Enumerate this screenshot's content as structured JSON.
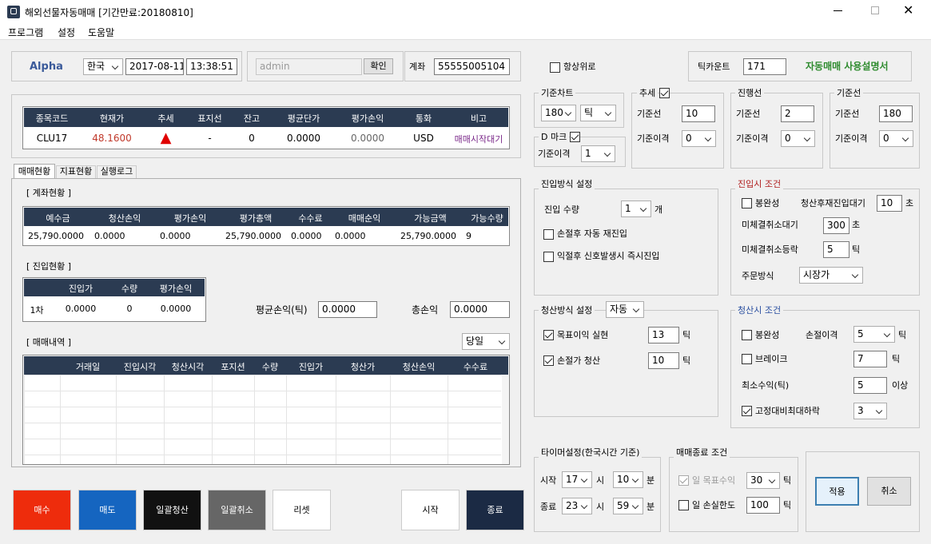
{
  "window": {
    "title": "해외선물자동매매 [기간만료:20180810]"
  },
  "menu": [
    "프로그램",
    "설정",
    "도움말"
  ],
  "header": {
    "brand": "Alpha",
    "country": "한국",
    "date": "2017-08-11",
    "time": "13:38:51",
    "user": "admin",
    "confirm": "확인",
    "account_label": "계좌",
    "account": "55555005104",
    "always_top": "항상위로",
    "tick_label": "틱카운트",
    "tick_count": "171",
    "manual": "자동매매 사용설명서"
  },
  "quote": {
    "headers": [
      "종목코드",
      "현재가",
      "추세",
      "표지선",
      "잔고",
      "평균단가",
      "평가손익",
      "통화",
      "비고"
    ],
    "row": [
      "CLU17",
      "48.1600",
      "▲",
      "-",
      "0",
      "0.0000",
      "0.0000",
      "USD",
      "매매시작대기"
    ]
  },
  "tabs": [
    "매매현황",
    "지표현황",
    "실행로그"
  ],
  "account": {
    "title": "[ 계좌현황 ]",
    "headers": [
      "예수금",
      "청산손익",
      "평가손익",
      "평가총액",
      "수수료",
      "매매순익",
      "가능금액",
      "가능수량"
    ],
    "row": [
      "25,790.0000",
      "0.0000",
      "0.0000",
      "25,790.0000",
      "0.0000",
      "0.0000",
      "25,790.0000",
      "9"
    ]
  },
  "entry": {
    "title": "[ 진입현황 ]",
    "headers": [
      "진입가",
      "수량",
      "평가손익"
    ],
    "row_label": "1차",
    "row": [
      "0.0000",
      "0",
      "0.0000"
    ],
    "avg_label": "평균손익(틱)",
    "avg_value": "0.0000",
    "total_label": "총손익",
    "total_value": "0.0000"
  },
  "trades": {
    "title": "[ 매매내역 ]",
    "filter": "당일",
    "headers": [
      "거래일",
      "진입시각",
      "청산시각",
      "포지션",
      "수량",
      "진입가",
      "청산가",
      "청산손익",
      "수수료"
    ]
  },
  "buttons": {
    "buy": "매수",
    "sell": "매도",
    "liquidate_all": "일괄청산",
    "cancel_all": "일괄취소",
    "reset": "리셋",
    "start": "시작",
    "stop": "종료",
    "apply": "적용",
    "cancel": "취소"
  },
  "chart_cfg": {
    "title": "기준차트",
    "period": "180",
    "unit": "틱",
    "dmark": "D 마크",
    "gap_label": "기준이격",
    "gap": "1"
  },
  "trend": {
    "title": "추세",
    "base_label": "기준선",
    "base": "10",
    "gap_label": "기준이격",
    "gap": "0"
  },
  "progress": {
    "title": "진행선",
    "base_label": "기준선",
    "base": "2",
    "gap_label": "기준이격",
    "gap": "0"
  },
  "baseline": {
    "title": "기준선",
    "base_label": "기준선",
    "base": "180",
    "gap_label": "기준이격",
    "gap": "0"
  },
  "entry_method": {
    "title": "진입방식 설정",
    "qty_label": "진입 수량",
    "qty": "1",
    "qty_unit": "개",
    "opt1": "손절후 자동 재진입",
    "opt2": "익절후 신호발생시 즉시진입"
  },
  "entry_cond": {
    "title": "진입시 조건",
    "bong": "봉완성",
    "wait_label": "청산후재진입대기",
    "wait": "10",
    "wait_unit": "초",
    "unfilled_label": "미체결취소대기",
    "unfilled": "300",
    "unfilled_unit": "초",
    "rise_label": "미체결취소등락",
    "rise": "5",
    "rise_unit": "틱",
    "order_label": "주문방식",
    "order": "시장가"
  },
  "exit_method": {
    "title": "청산방식 설정",
    "mode": "자동",
    "target_label": "목표이익 실현",
    "target": "13",
    "target_unit": "틱",
    "stop_label": "손절가 청산",
    "stop": "10",
    "stop_unit": "틱"
  },
  "exit_cond": {
    "title": "청산시 조건",
    "bong": "봉완성",
    "gap_label": "손절이격",
    "gap": "5",
    "gap_unit": "틱",
    "brake": "브레이크",
    "brake_val": "7",
    "brake_unit": "틱",
    "min_label": "최소수익(틱)",
    "min": "5",
    "min_unit": "이상",
    "fixed": "고정대비최대하락",
    "fixed_val": "3"
  },
  "timer": {
    "title": "타이머설정(한국시간 기준)",
    "start_label": "시작",
    "start_h": "17",
    "start_m": "10",
    "end_label": "종료",
    "end_h": "23",
    "end_m": "59",
    "h_unit": "시",
    "m_unit": "분"
  },
  "end_cond": {
    "title": "매매종료 조건",
    "target_label": "일 목표수익",
    "target": "30",
    "target_unit": "틱",
    "loss_label": "일 손실한도",
    "loss": "100",
    "loss_unit": "틱"
  },
  "colors": {
    "header": "#2b3b52",
    "buy": "#ee2c0c",
    "sell": "#1565c0",
    "dark": "#111111",
    "gray": "#666666",
    "navy": "#1b2a44",
    "green": "#2e8b2e"
  }
}
